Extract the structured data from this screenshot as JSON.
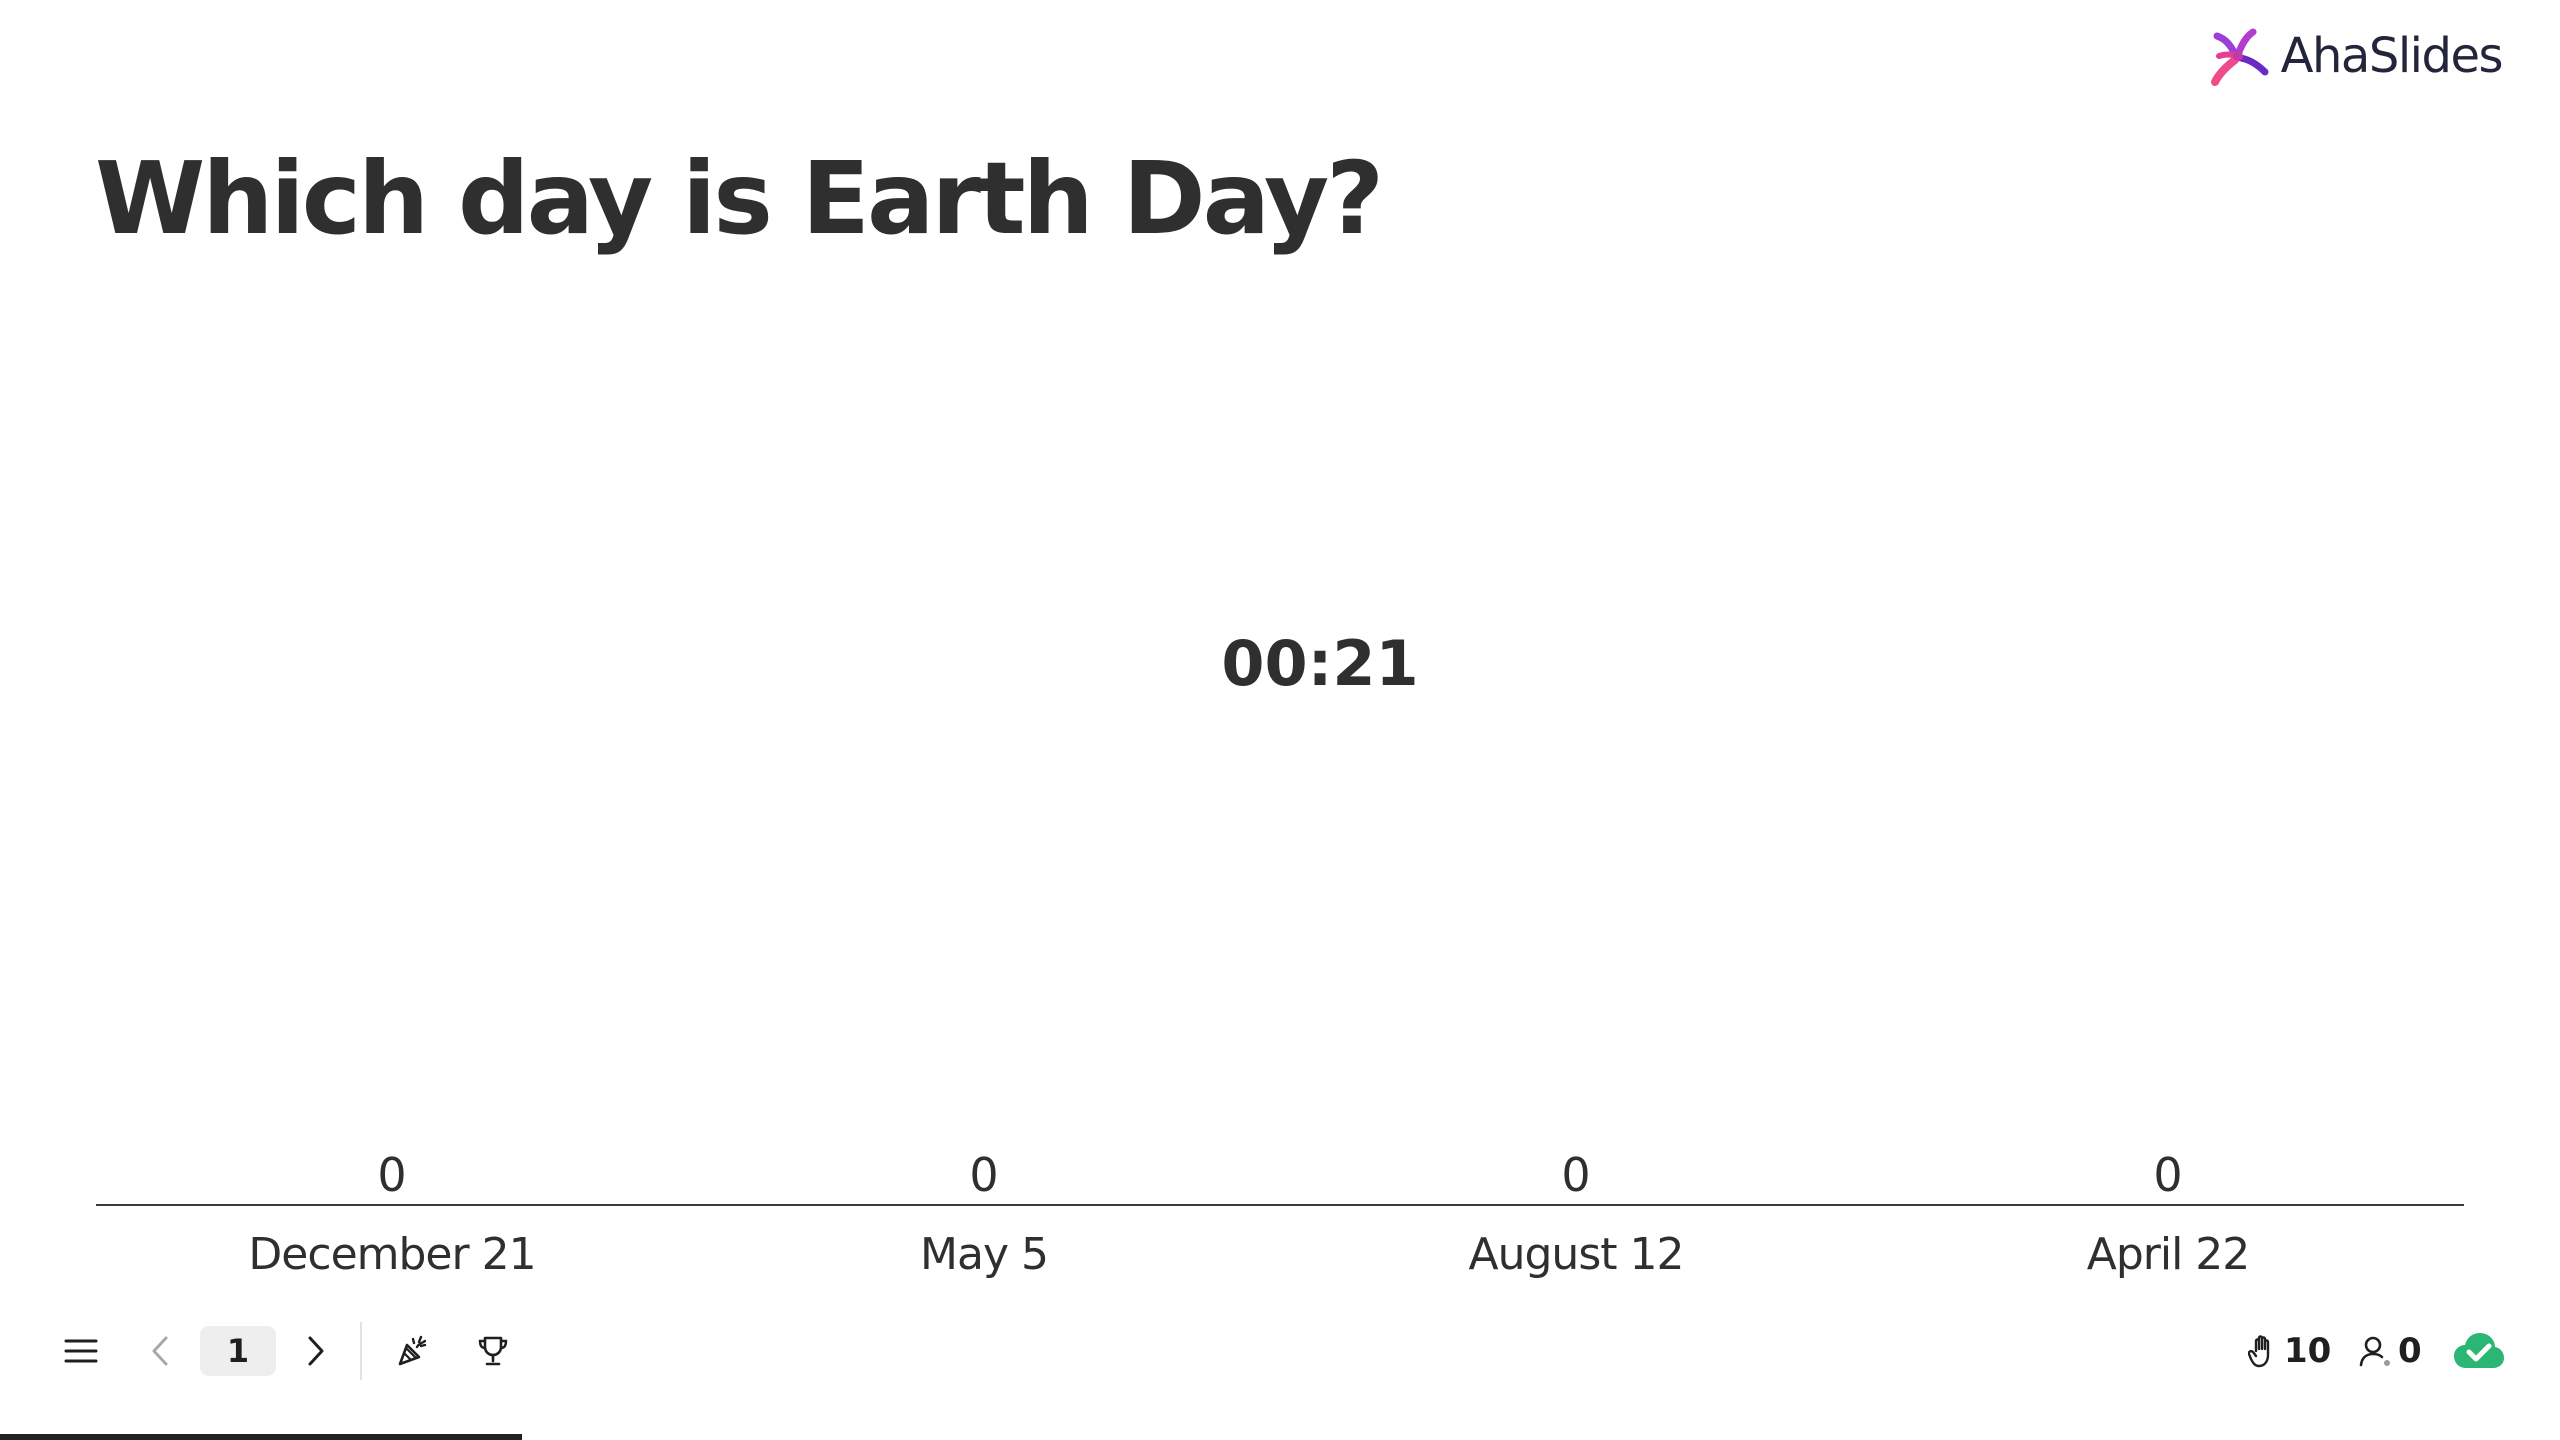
{
  "brand": {
    "name": "AhaSlides"
  },
  "slide": {
    "title": "Which day is Earth Day?",
    "timer": "00:21"
  },
  "chart_data": {
    "type": "bar",
    "categories": [
      "December 21",
      "May 5",
      "August 12",
      "April 22"
    ],
    "values": [
      0,
      0,
      0,
      0
    ]
  },
  "toolbar": {
    "page_number": "1",
    "reactions_count": "10",
    "participants_count": "0"
  },
  "progress": {
    "fraction": 0.204
  },
  "colors": {
    "accent_green": "#2bb673",
    "logo_pink": "#e8407a",
    "logo_purple": "#7b2fd1"
  }
}
